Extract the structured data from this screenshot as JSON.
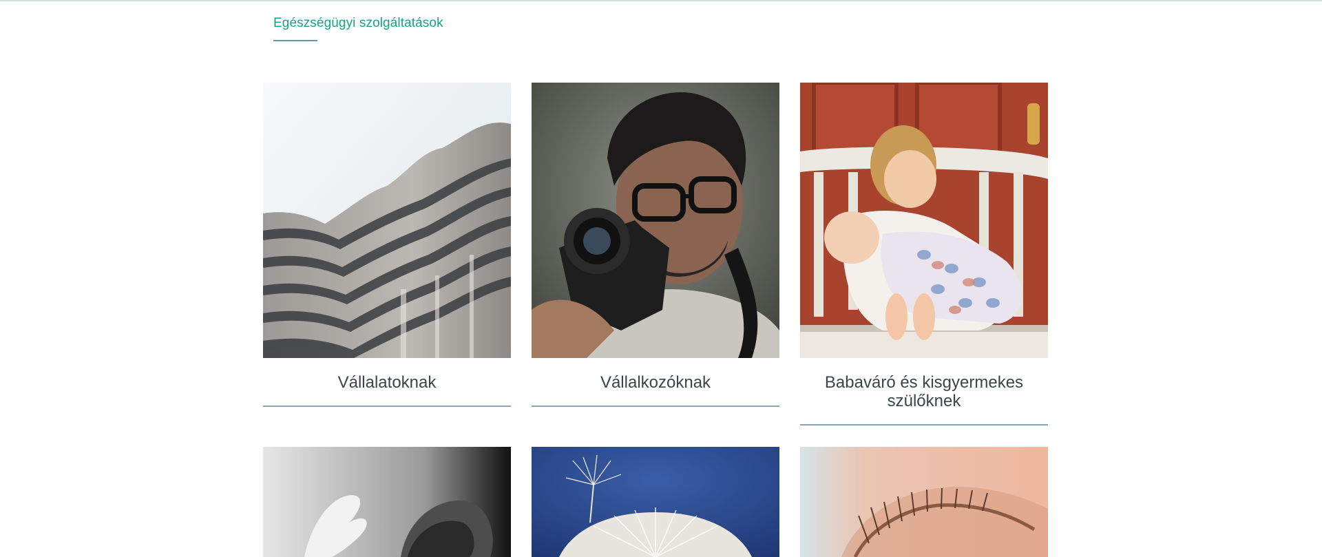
{
  "section": {
    "title": "Egészségügyi szolgáltatások"
  },
  "cards": [
    {
      "title": "Vállalatoknak",
      "image": "curved-building-facade-photo"
    },
    {
      "title": "Vállalkozóknak",
      "image": "man-with-camera-photo"
    },
    {
      "title": "Babaváró és kisgyermekes szülőknek",
      "image": "child-kissing-newborn-photo"
    },
    {
      "title": "",
      "image": "baby-hand-black-white-photo"
    },
    {
      "title": "",
      "image": "dandelion-seeds-blue-sky-photo"
    },
    {
      "title": "",
      "image": "newborn-eye-closeup-photo"
    }
  ],
  "colors": {
    "accent": "#12a57f",
    "title_text": "#3c4547",
    "rule": "#8aa3b0"
  }
}
